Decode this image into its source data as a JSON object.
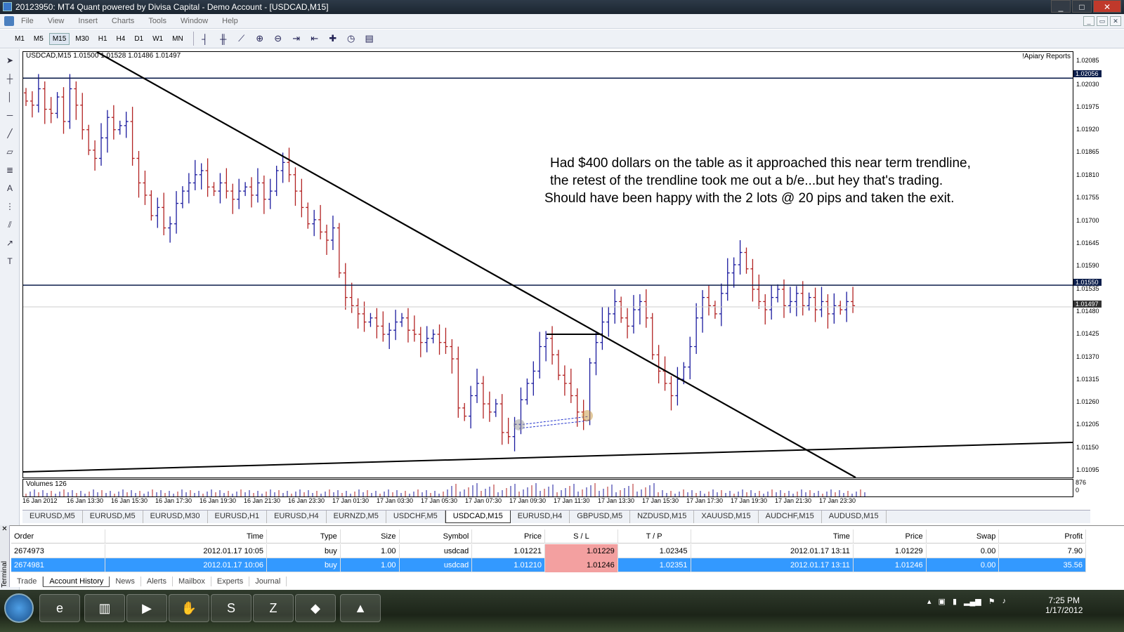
{
  "window": {
    "title": "20123950: MT4 Quant powered by Divisa Capital - Demo Account - [USDCAD,M15]"
  },
  "menu": [
    "File",
    "View",
    "Insert",
    "Charts",
    "Tools",
    "Window",
    "Help"
  ],
  "timeframes": [
    "M1",
    "M5",
    "M15",
    "M30",
    "H1",
    "H4",
    "D1",
    "W1",
    "MN"
  ],
  "active_timeframe": "M15",
  "chart": {
    "info": "USDCAD,M15  1.01500 1.01528 1.01486 1.01497",
    "indicator": "!Apiary Reports",
    "annotation": [
      "Had $400 dollars on the table as it approached this near term trendline,",
      "the retest of the trendline took me out a b/e...but hey that's trading.",
      "Should have been happy with the 2 lots @ 20 pips and taken the exit."
    ],
    "price_labels": [
      "1.02085",
      "1.02056",
      "1.02030",
      "1.01975",
      "1.01920",
      "1.01865",
      "1.01810",
      "1.01755",
      "1.01700",
      "1.01645",
      "1.01590",
      "1.01550",
      "1.01535",
      "1.01480",
      "1.01497",
      "1.01425",
      "1.01370",
      "1.01315",
      "1.01260",
      "1.01205",
      "1.01150",
      "1.01095"
    ],
    "volume_label": "Volumes 126",
    "volume_axis": [
      "876",
      "0"
    ],
    "time_labels": [
      "16 Jan 2012",
      "16 Jan 13:30",
      "16 Jan 15:30",
      "16 Jan 17:30",
      "16 Jan 19:30",
      "16 Jan 21:30",
      "16 Jan 23:30",
      "17 Jan 01:30",
      "17 Jan 03:30",
      "17 Jan 05:30",
      "17 Jan 07:30",
      "17 Jan 09:30",
      "17 Jan 11:30",
      "17 Jan 13:30",
      "17 Jan 15:30",
      "17 Jan 17:30",
      "17 Jan 19:30",
      "17 Jan 21:30",
      "17 Jan 23:30"
    ]
  },
  "chart_tabs": [
    "EURUSD,M5",
    "EURUSD,M5",
    "EURUSD,M30",
    "EURUSD,H1",
    "EURUSD,H4",
    "EURNZD,M5",
    "USDCHF,M5",
    "USDCAD,M15",
    "EURUSD,H4",
    "GBPUSD,M5",
    "NZDUSD,M15",
    "XAUUSD,M15",
    "AUDCHF,M15",
    "AUDUSD,M15"
  ],
  "active_chart_tab": "USDCAD,M15",
  "terminal": {
    "side_label": "Terminal",
    "columns": [
      "Order",
      "Time",
      "Type",
      "Size",
      "Symbol",
      "Price",
      "S / L",
      "T / P",
      "Time",
      "Price",
      "Swap",
      "Profit"
    ],
    "rows": [
      [
        "2674973",
        "2012.01.17 10:05",
        "buy",
        "1.00",
        "usdcad",
        "1.01221",
        "1.01229",
        "1.02345",
        "2012.01.17 13:11",
        "1.01229",
        "0.00",
        "7.90"
      ],
      [
        "2674981",
        "2012.01.17 10:06",
        "buy",
        "1.00",
        "usdcad",
        "1.01210",
        "1.01246",
        "1.02351",
        "2012.01.17 13:11",
        "1.01246",
        "0.00",
        "35.56"
      ]
    ],
    "tabs": [
      "Trade",
      "Account History",
      "News",
      "Alerts",
      "Mailbox",
      "Experts",
      "Journal"
    ],
    "active_tab": "Account History"
  },
  "taskbar": {
    "time": "7:25 PM",
    "date": "1/17/2012"
  },
  "colors": {
    "bull": "#1a1a9e",
    "bear": "#b22222",
    "hline": "#0c1e4b",
    "selected_row": "#3399ff",
    "sl_cell": "#f3a0a0"
  }
}
